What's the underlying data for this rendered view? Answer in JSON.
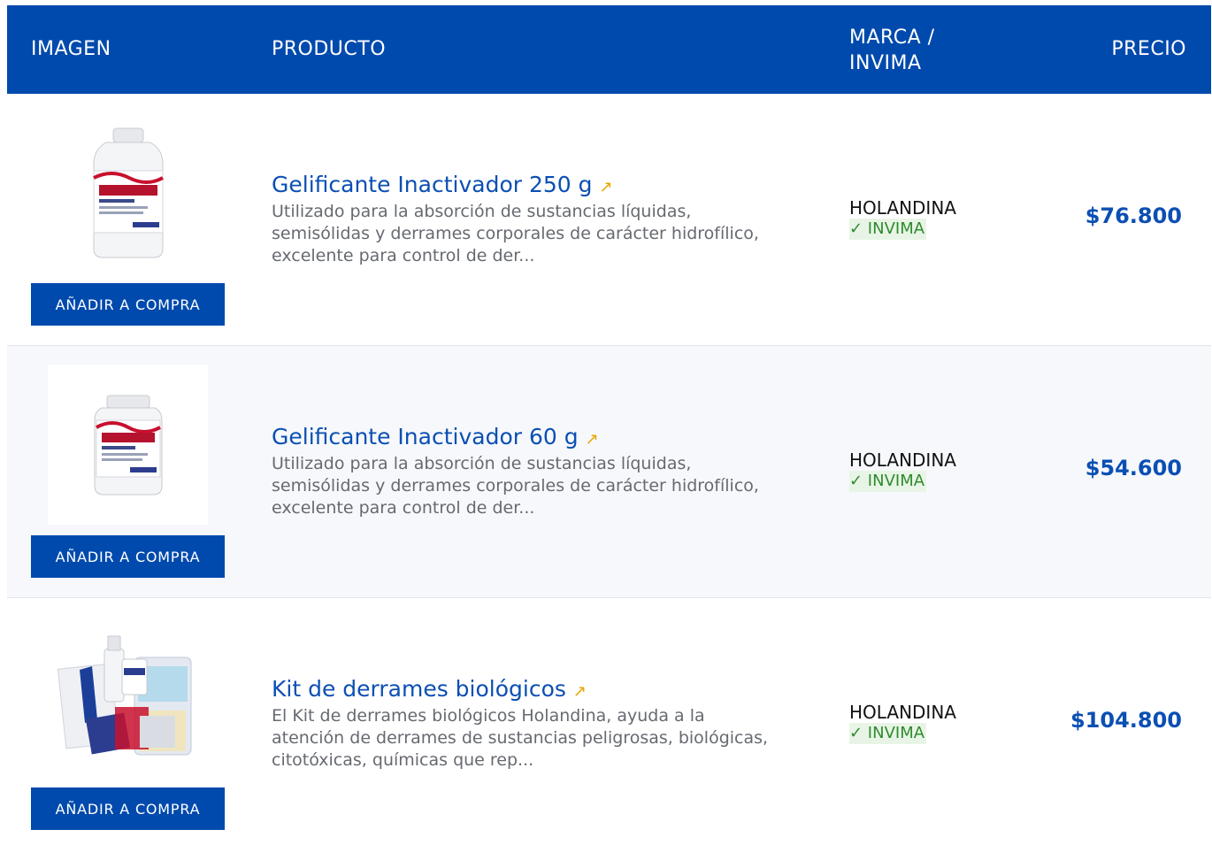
{
  "header": {
    "image": "IMAGEN",
    "product": "PRODUCTO",
    "brand": "MARCA / INVIMA",
    "price": "PRECIO"
  },
  "rows": [
    {
      "title": "Gelificante Inactivador 250 g",
      "description": "Utilizado para la absorción de sustancias líquidas, semisólidas y derrames corporales de carácter hidrofílico, excelente para control de der...",
      "brand": "HOLANDINA",
      "invima": "✓ INVIMA",
      "price": "$76.800",
      "button": "AÑADIR A COMPRA"
    },
    {
      "title": "Gelificante Inactivador 60 g",
      "description": "Utilizado para la absorción de sustancias líquidas, semisólidas y derrames corporales de carácter hidrofílico, excelente para control de der...",
      "brand": "HOLANDINA",
      "invima": "✓ INVIMA",
      "price": "$54.600",
      "button": "AÑADIR A COMPRA"
    },
    {
      "title": "Kit de derrames biológicos",
      "description": "El Kit de derrames biológicos Holandina, ayuda a la atención de derrames de sustancias peligrosas, biológicas, citotóxicas, químicas que rep...",
      "brand": "HOLANDINA",
      "invima": "✓ INVIMA",
      "price": "$104.800",
      "button": "AÑADIR A COMPRA"
    }
  ],
  "icons": {
    "external_link": "↗"
  },
  "colors": {
    "primary": "#004aad",
    "link": "#0b4fb3",
    "accent": "#e8a500",
    "invima_text": "#2e8b2e",
    "invima_bg": "#e8f5e6"
  }
}
